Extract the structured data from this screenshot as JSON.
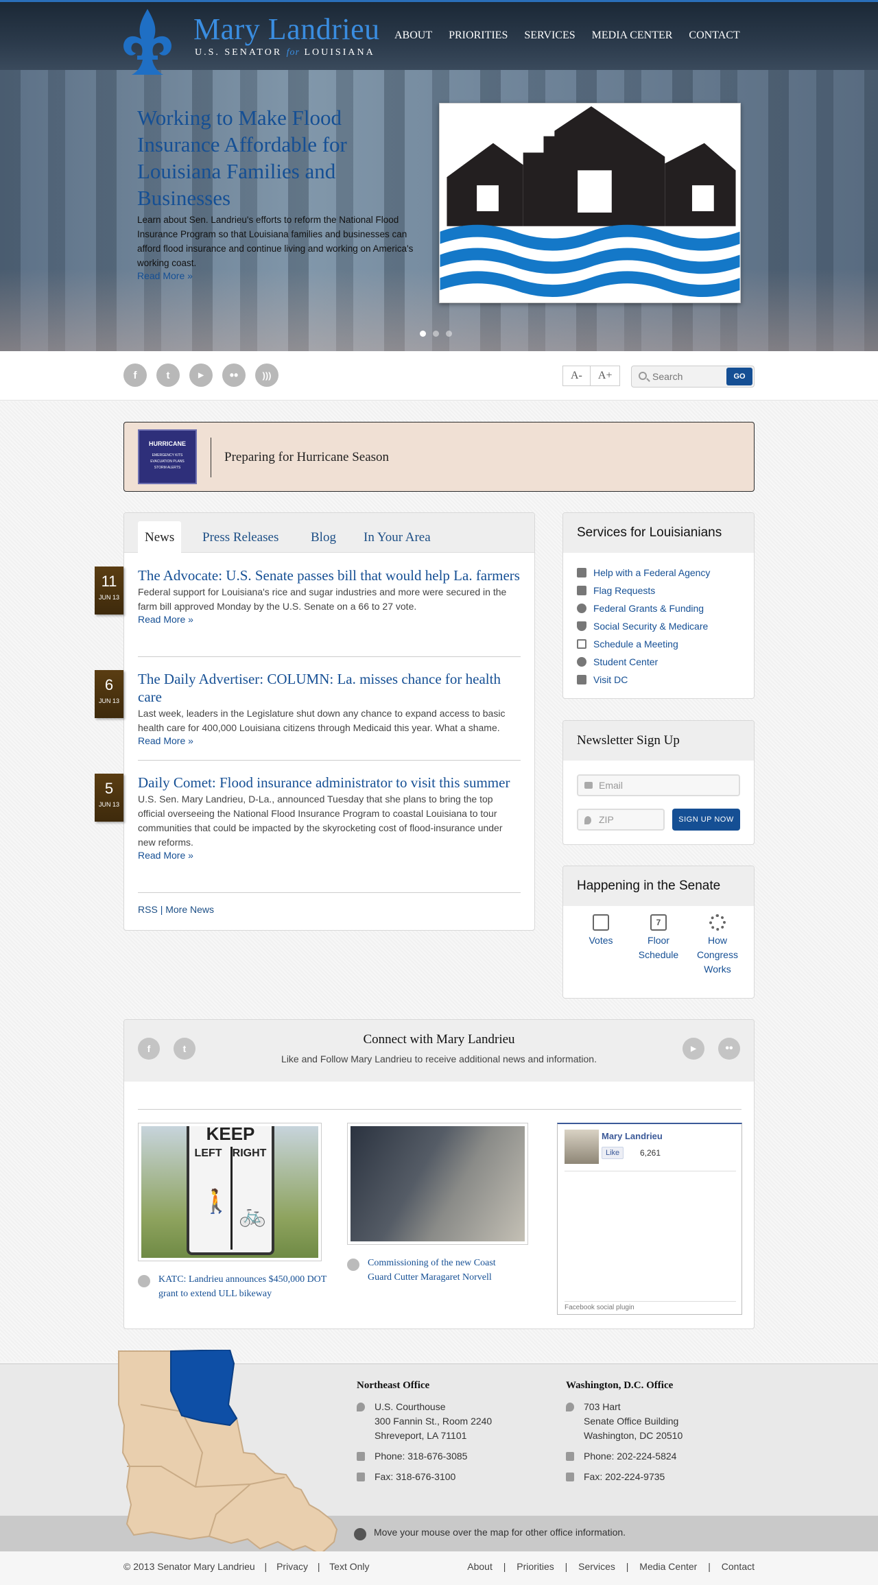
{
  "header": {
    "name": "Mary Landrieu",
    "sub_left": "U.S. SENATOR",
    "sub_for": "for",
    "sub_right": "LOUISIANA",
    "nav": [
      "ABOUT",
      "PRIORITIES",
      "SERVICES",
      "MEDIA CENTER",
      "CONTACT"
    ]
  },
  "hero": {
    "title": "Working to Make Flood Insurance Affordable for Louisiana Families and Businesses",
    "body": "Learn about Sen. Landrieu's efforts to reform the National Flood Insurance Program so that Louisiana families and businesses can afford flood insurance and continue living and working on America's working coast.",
    "more": "Read More »"
  },
  "util": {
    "font_smaller": "A-",
    "font_larger": "A+",
    "search_placeholder": "Search",
    "search_go": "GO"
  },
  "banner": {
    "thumb_title": "HURRICANE",
    "thumb_lines": [
      "EMERGENCY KITS",
      "EVACUATION PLANS",
      "STORM ALERTS"
    ],
    "text": "Preparing for Hurricane Season"
  },
  "news": {
    "tabs": [
      "News",
      "Press Releases",
      "Blog",
      "In Your Area"
    ],
    "items": [
      {
        "day": "11",
        "month": "JUN 13",
        "title": "The Advocate: U.S. Senate passes bill that would help La. farmers",
        "body": "Federal support for Louisiana's rice and sugar industries and more were secured in the farm bill approved Monday by the U.S. Senate on a 66 to 27 vote.",
        "more": "Read More »"
      },
      {
        "day": "6",
        "month": "JUN 13",
        "title": "The Daily Advertiser: COLUMN: La. misses chance for health care",
        "body": "Last week, leaders in the Legislature shut down any chance to expand access to basic health care for 400,000 Louisiana citizens through Medicaid this year. What a shame.",
        "more": "Read More »"
      },
      {
        "day": "5",
        "month": "JUN 13",
        "title": "Daily Comet: Flood insurance administrator to visit this summer",
        "body": "U.S. Sen. Mary Landrieu, D-La., announced Tuesday that she plans to bring the top official overseeing the National Flood Insurance Program to coastal Louisiana to tour communities that could be impacted by the skyrocketing cost of flood-insurance under new reforms.",
        "more": "Read More »"
      }
    ],
    "rss": "RSS",
    "pipe": "|",
    "more_news": "More News"
  },
  "services": {
    "title": "Services for Louisianians",
    "items": [
      {
        "label": "Help with a Federal Agency",
        "icon": "briefcase-icon"
      },
      {
        "label": "Flag Requests",
        "icon": "flag-icon"
      },
      {
        "label": "Federal Grants & Funding",
        "icon": "dollar-icon"
      },
      {
        "label": "Social Security & Medicare",
        "icon": "shield-icon"
      },
      {
        "label": "Schedule a Meeting",
        "icon": "calendar-icon"
      },
      {
        "label": "Student Center",
        "icon": "apple-icon"
      },
      {
        "label": "Visit DC",
        "icon": "capitol-icon"
      }
    ]
  },
  "newsletter": {
    "title": "Newsletter Sign Up",
    "email_placeholder": "Email",
    "zip_placeholder": "ZIP",
    "button": "SIGN UP NOW"
  },
  "senate": {
    "title": "Happening in the Senate",
    "links": [
      {
        "label": "Votes",
        "icon": "checkbox-icon"
      },
      {
        "label": "Floor Schedule",
        "icon": "calendar-icon",
        "icon_text": "7"
      },
      {
        "label": "How Congress Works",
        "icon": "gears-icon"
      }
    ]
  },
  "connect": {
    "title": "Connect with Mary Landrieu",
    "subtitle": "Like and Follow Mary Landrieu to receive additional news and information.",
    "media": [
      {
        "caption": "KATC: Landrieu announces $450,000 DOT grant to extend ULL bikeway",
        "icon": "youtube-icon",
        "sign_top": "KEEP",
        "sign_left": "LEFT",
        "sign_right": "RIGHT"
      },
      {
        "caption": "Commissioning of the new Coast Guard Cutter Maragaret Norvell",
        "icon": "flickr-icon"
      }
    ],
    "facebook": {
      "name": "Mary Landrieu",
      "like": "Like",
      "count": "6,261",
      "plugin": "Facebook social plugin"
    }
  },
  "offices": {
    "northeast": {
      "title": "Northeast Office",
      "address": [
        "U.S. Courthouse",
        "300 Fannin St., Room 2240",
        "Shreveport, LA 71101"
      ],
      "phone": "Phone: 318-676-3085",
      "fax": "Fax: 318-676-3100"
    },
    "dc": {
      "title": "Washington, D.C. Office",
      "address": [
        "703 Hart",
        "Senate Office Building",
        "Washington, DC 20510"
      ],
      "phone": "Phone: 202-224-5824",
      "fax": "Fax: 202-224-9735"
    },
    "map_hint": "Move your mouse over the map for other office information."
  },
  "footer": {
    "copyright": "© 2013 Senator Mary Landrieu",
    "privacy": "Privacy",
    "text_only": "Text Only",
    "pipe": "|",
    "nav": [
      "About",
      "Priorities",
      "Services",
      "Media Center",
      "Contact"
    ]
  },
  "colors": {
    "brand_blue": "#154f94",
    "light_blue": "#3a8de0",
    "banner_bg": "#f0e0d4",
    "date_brown": "#4a3210"
  }
}
